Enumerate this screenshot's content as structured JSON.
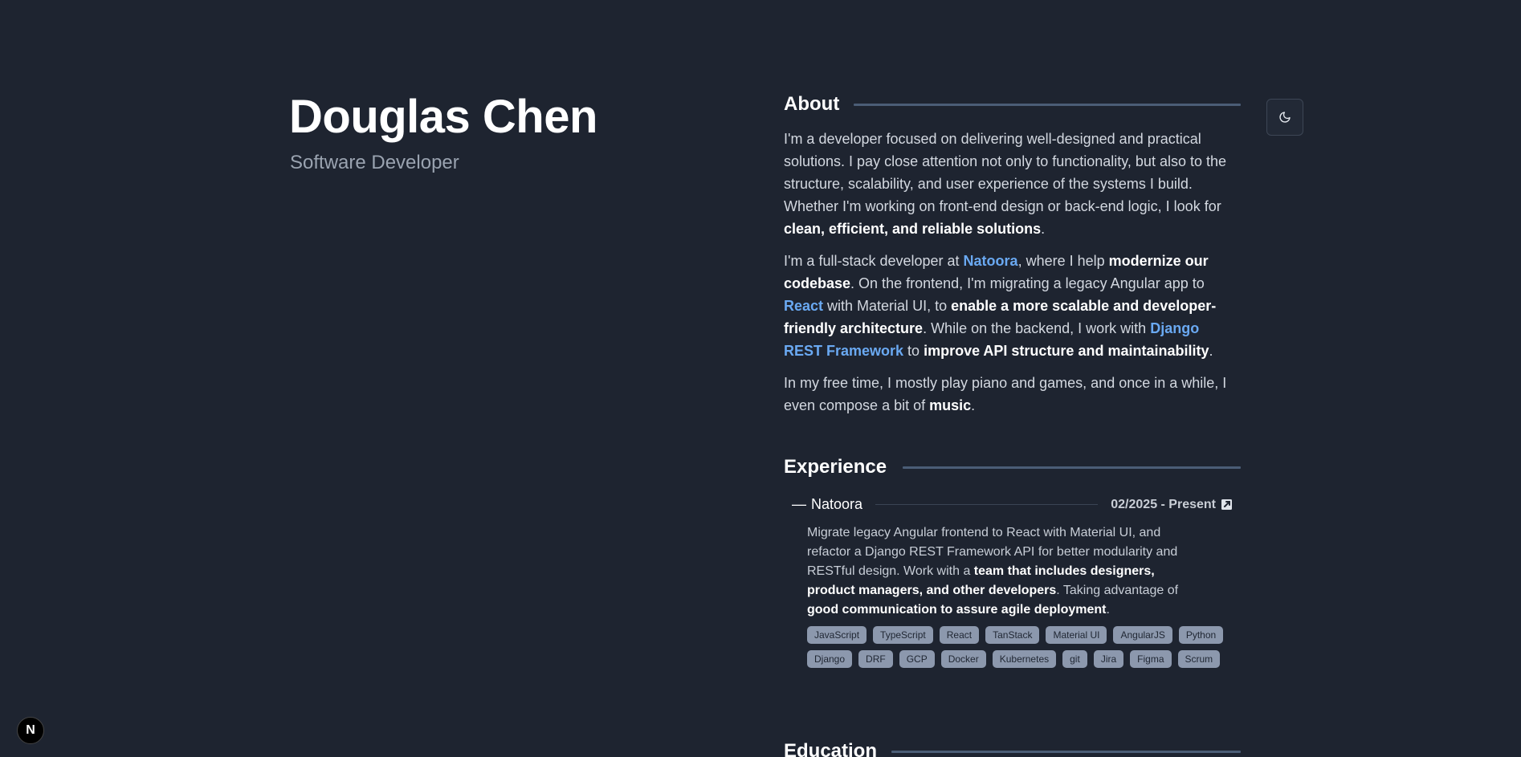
{
  "header": {
    "name": "Douglas Chen",
    "role": "Software Developer"
  },
  "theme_toggle": {
    "icon": "moon-icon"
  },
  "about": {
    "title": "About",
    "p1": [
      {
        "t": "I'm a developer focused on delivering well-designed and practical solutions. I pay close attention not only to functionality, but also to the structure, scalability, and user experience of the systems I build. Whether I'm working on front-end design or back-end logic, I look for ",
        "s": "n"
      },
      {
        "t": "clean, efficient, and reliable solutions",
        "s": "b"
      },
      {
        "t": ".",
        "s": "n"
      }
    ],
    "p2": [
      {
        "t": "I'm a full-stack developer at ",
        "s": "n"
      },
      {
        "t": "Natoora",
        "s": "a"
      },
      {
        "t": ", where I help ",
        "s": "n"
      },
      {
        "t": "modernize our codebase",
        "s": "b"
      },
      {
        "t": ". On the frontend, I'm migrating a legacy Angular app to ",
        "s": "n"
      },
      {
        "t": "React",
        "s": "a"
      },
      {
        "t": " with Material UI, to ",
        "s": "n"
      },
      {
        "t": "enable a more scalable and developer-friendly architecture",
        "s": "b"
      },
      {
        "t": ". While on the backend, I work with ",
        "s": "n"
      },
      {
        "t": "Django REST Framework",
        "s": "a"
      },
      {
        "t": " to ",
        "s": "n"
      },
      {
        "t": "improve API structure and maintainability",
        "s": "b"
      },
      {
        "t": ".",
        "s": "n"
      }
    ],
    "p3": [
      {
        "t": "In my free time, I mostly play piano and games, and once in a while, I even compose a bit of ",
        "s": "n"
      },
      {
        "t": "music",
        "s": "b"
      },
      {
        "t": ".",
        "s": "n"
      }
    ]
  },
  "experience": {
    "title": "Experience",
    "items": [
      {
        "dash": "—",
        "company": "Natoora",
        "dates": "02/2025 - Present",
        "link_icon": "external-link-icon",
        "desc": [
          {
            "t": "Migrate legacy Angular frontend to React with Material UI, and refactor a Django REST Framework API for better modularity and RESTful design. Work with a ",
            "s": "n"
          },
          {
            "t": "team that includes designers, product managers, and other developers",
            "s": "b"
          },
          {
            "t": ". Taking advantage of ",
            "s": "n"
          },
          {
            "t": "good communication to assure agile deployment",
            "s": "b"
          },
          {
            "t": ".",
            "s": "n"
          }
        ],
        "tags": [
          "JavaScript",
          "TypeScript",
          "React",
          "TanStack",
          "Material UI",
          "AngularJS",
          "Python",
          "Django",
          "DRF",
          "GCP",
          "Docker",
          "Kubernetes",
          "git",
          "Jira",
          "Figma",
          "Scrum"
        ]
      }
    ]
  },
  "education": {
    "title": "Education"
  },
  "nextjs_badge": {
    "label": "N"
  }
}
